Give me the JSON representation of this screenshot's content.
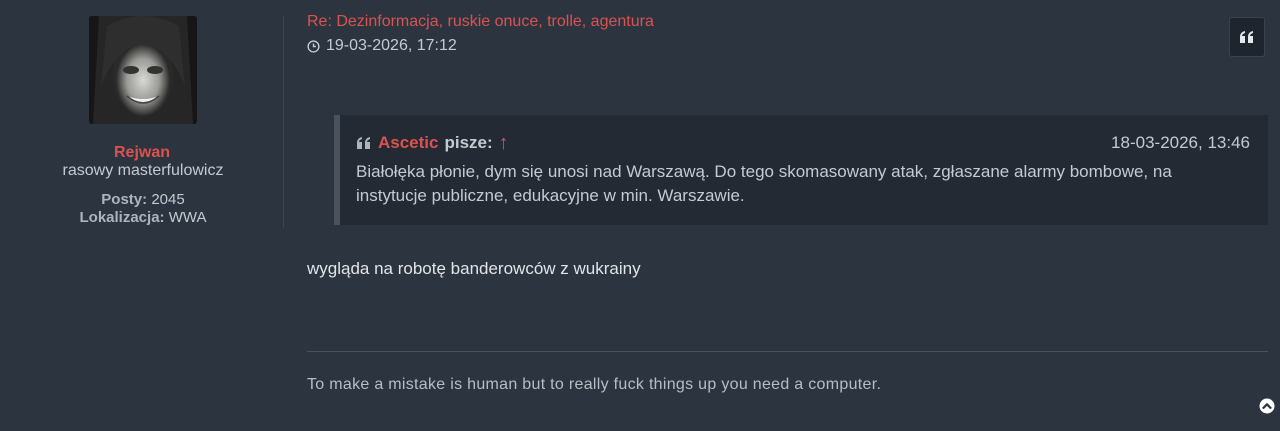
{
  "author": {
    "username": "Rejwan",
    "rank": "rasowy masterfulowicz",
    "posts_label": "Posty:",
    "posts_value": "2045",
    "location_label": "Lokalizacja:",
    "location_value": "WWA"
  },
  "post": {
    "title": "Re: Dezinformacja, ruskie onuce, trolle, agentura",
    "date": "19-03-2026, 17:12",
    "quote": {
      "author": "Ascetic",
      "says": "pisze:",
      "up_arrow": "↑",
      "date": "18-03-2026, 13:46",
      "text": "Białołęka płonie, dym się unosi nad Warszawą. Do tego skomasowany atak, zgłaszane alarmy bombowe, na instytucje publiczne, edukacyjne w min. Warszawie."
    },
    "body": "wygląda na robotę banderowców z wukrainy",
    "signature": "To make a mistake is human but to really fuck things up you need a computer."
  },
  "colors": {
    "background": "#2c3440",
    "accent": "#d9534f",
    "quote_bg": "#232a33"
  },
  "icons": {
    "clock": "clock-icon",
    "quote": "quote-icon",
    "back_to_top": "back-to-top-icon"
  }
}
